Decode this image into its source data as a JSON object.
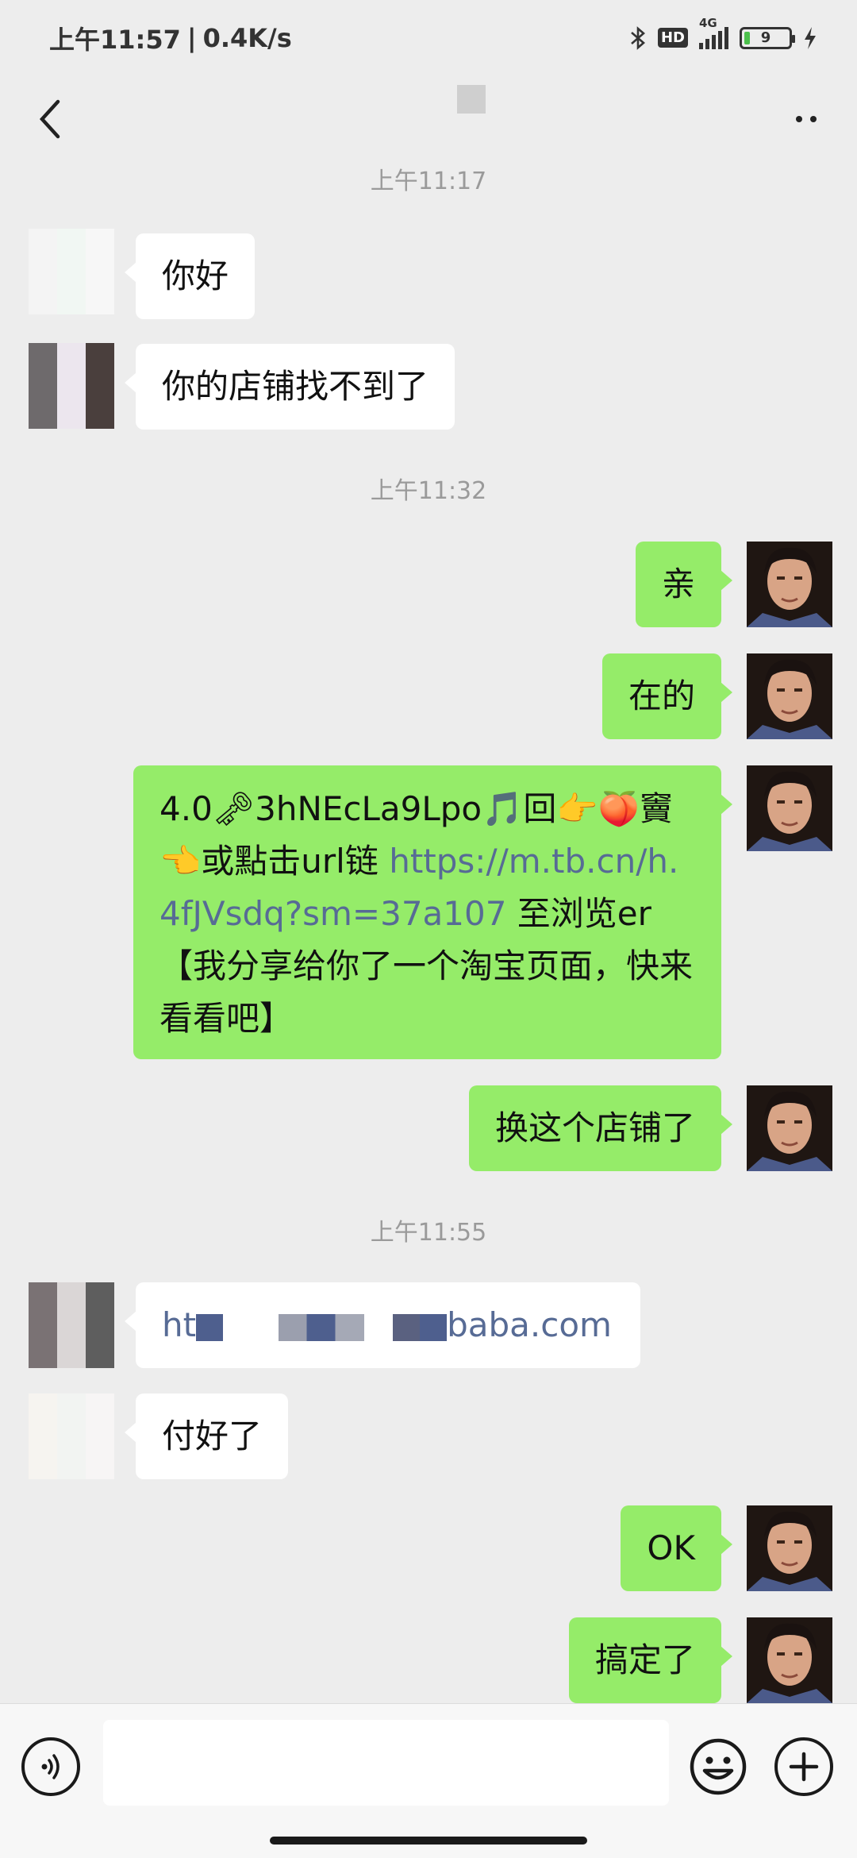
{
  "status_bar": {
    "time": "上午11:57",
    "network_speed": "0.4K/s",
    "hd_label": "HD",
    "signal_label": "4G",
    "battery": "9",
    "icons": [
      "bluetooth-icon",
      "hd-icon",
      "signal-icon",
      "battery-icon",
      "charging-icon"
    ]
  },
  "header": {
    "back_icon": "chevron-left-icon",
    "more_icon": "more-dots-icon"
  },
  "messages": [
    {
      "type": "timestamp",
      "text": "上午11:17"
    },
    {
      "type": "message",
      "side": "left",
      "text": "你好"
    },
    {
      "type": "message",
      "side": "left",
      "text": "你的店铺找不到了"
    },
    {
      "type": "timestamp",
      "text": "上午11:32"
    },
    {
      "type": "message",
      "side": "right",
      "text": "亲"
    },
    {
      "type": "message",
      "side": "right",
      "text": "在的"
    },
    {
      "type": "message",
      "side": "right",
      "text_before": "4.0🗝3hNEcLa9Lpo🎵回👉🍑竇👈或點击url链 ",
      "link": "https://m.tb.cn/h.4fJVsdq?sm=37a107",
      "text_after": " 至浏览er【我分享给你了一个淘宝页面，快来看看吧】"
    },
    {
      "type": "message",
      "side": "right",
      "text": "换这个店铺了"
    },
    {
      "type": "timestamp",
      "text": "上午11:55"
    },
    {
      "type": "message",
      "side": "left",
      "link_start": "ht",
      "link_end": "baba.com"
    },
    {
      "type": "message",
      "side": "left",
      "text": "付好了"
    },
    {
      "type": "message",
      "side": "right",
      "text": "OK"
    },
    {
      "type": "message",
      "side": "right",
      "text": "搞定了"
    }
  ],
  "input_bar": {
    "placeholder": "",
    "icons": [
      "voice-icon",
      "emoji-icon",
      "plus-icon"
    ]
  },
  "colors": {
    "background": "#ededed",
    "bubble_self": "#95ec69",
    "bubble_other": "#ffffff",
    "link": "#576b95",
    "timestamp": "#9a9a9a"
  }
}
